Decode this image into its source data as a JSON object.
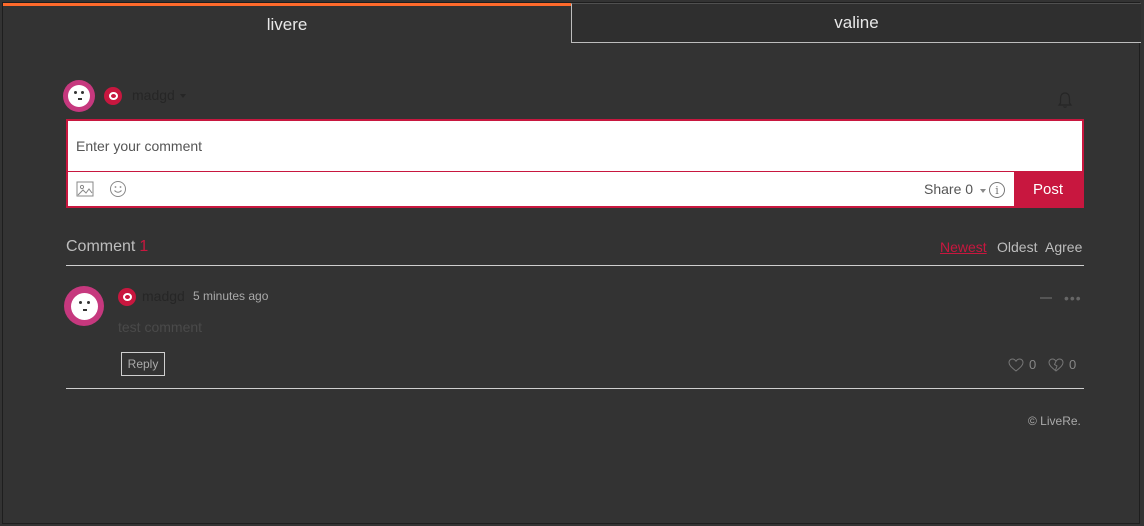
{
  "tabs": [
    {
      "label": "livere",
      "active": true
    },
    {
      "label": "valine",
      "active": false
    }
  ],
  "header": {
    "username": "madgd",
    "avatar_color": "#c6387e",
    "notification_icon": "bell-icon"
  },
  "composer": {
    "placeholder": "Enter your comment",
    "value": "",
    "image_icon": "image-icon",
    "emoji_icon": "smiley-icon",
    "share_label": "Share",
    "share_count": "0",
    "info_icon": "info-icon",
    "post_label": "Post"
  },
  "comments_section": {
    "title": "Comment",
    "count": "1",
    "sort_options": [
      "Newest",
      "Oldest",
      "Agree"
    ],
    "active_sort": "Newest"
  },
  "comments": [
    {
      "username": "madgd",
      "time": "5 minutes ago",
      "text": "test comment",
      "reply_label": "Reply",
      "likes": "0",
      "dislikes": "0"
    }
  ],
  "footer": {
    "copyright": "© LiveRe."
  },
  "colors": {
    "accent": "#c8173f",
    "tab_indicator": "#ff6a2b",
    "background": "#333333"
  }
}
